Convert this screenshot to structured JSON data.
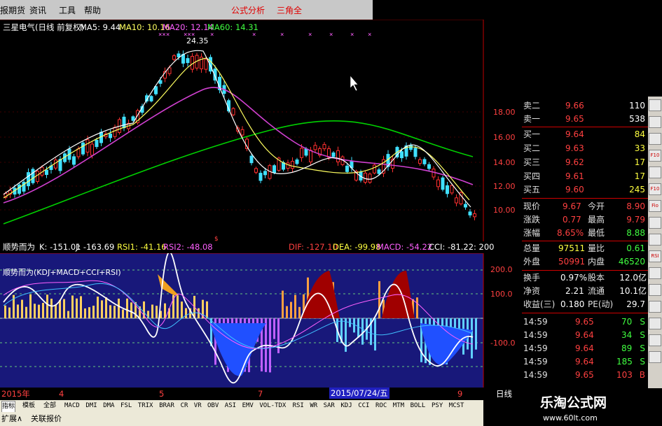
{
  "menu": {
    "items": [
      "报期货",
      "资讯",
      "工具",
      "帮助"
    ],
    "red_items": [
      "公式分析",
      "三角全"
    ]
  },
  "header": {
    "stock_name": "三星电气(日线 前复权)",
    "ma5": "MA5: 9.44",
    "ma10": "MA10: 10.16",
    "ma20": "MA20: 12.14",
    "ma60": "MA60: 14.31",
    "high_label": "24.35"
  },
  "price_axis": [
    "18.00",
    "16.00",
    "14.00",
    "12.00",
    "10.00"
  ],
  "indicator": {
    "name": "顺势而为",
    "k": "K: -151.01",
    "j": "J: -163.69",
    "rsi1": "RSI1: -41.16",
    "rsi2": "RSI2: -48.08",
    "dif": "DIF: -127.10",
    "dea": "DEA: -99.98",
    "macd": "MACD: -54.22",
    "cci": "CCI: -81.22",
    "extra": ": 200",
    "inner_title": "顺势而为(KDJ+MACD+CCI+RSI)"
  },
  "ind_axis": [
    "200.0",
    "100.0",
    "-100.0"
  ],
  "date_axis": {
    "year": "2015年",
    "m4": "4",
    "m5": "5",
    "m7": "7",
    "cursor_date": "2015/07/24/五",
    "m9": "9",
    "period": "日线"
  },
  "quote": {
    "sell2": {
      "label": "卖二",
      "price": "9.66",
      "vol": "110"
    },
    "sell1": {
      "label": "卖一",
      "price": "9.65",
      "vol": "538"
    },
    "buy1": {
      "label": "买一",
      "price": "9.64",
      "vol": "84"
    },
    "buy2": {
      "label": "买二",
      "price": "9.63",
      "vol": "33"
    },
    "buy3": {
      "label": "买三",
      "price": "9.62",
      "vol": "17"
    },
    "buy4": {
      "label": "买四",
      "price": "9.61",
      "vol": "17"
    },
    "buy5": {
      "label": "买五",
      "price": "9.60",
      "vol": "245"
    },
    "now": {
      "l1": "现价",
      "v1": "9.67",
      "l2": "今开",
      "v2": "8.90"
    },
    "chg": {
      "l1": "涨跌",
      "v1": "0.77",
      "l2": "最高",
      "v2": "9.79"
    },
    "pct": {
      "l1": "涨幅",
      "v1": "8.65%",
      "l2": "最低",
      "v2": "8.88"
    },
    "vol": {
      "l1": "总量",
      "v1": "97511",
      "l2": "量比",
      "v2": "0.61"
    },
    "outer": {
      "l1": "外盘",
      "v1": "50991",
      "l2": "内盘",
      "v2": "46520"
    },
    "turnover": {
      "l1": "换手",
      "v1": "0.97%",
      "l2": "股本",
      "v2": "12.0亿"
    },
    "nav": {
      "l1": "净资",
      "v1": "2.21",
      "l2": "流通",
      "v2": "10.1亿"
    },
    "eps": {
      "l1": "收益(三)",
      "v1": "0.180",
      "l2": "PE(动)",
      "v2": "29.7"
    }
  },
  "ticks": [
    {
      "time": "14:59",
      "price": "9.65",
      "vol": "70",
      "side": "S"
    },
    {
      "time": "14:59",
      "price": "9.64",
      "vol": "34",
      "side": "S"
    },
    {
      "time": "14:59",
      "price": "9.64",
      "vol": "89",
      "side": "S"
    },
    {
      "time": "14:59",
      "price": "9.64",
      "vol": "185",
      "side": "S"
    },
    {
      "time": "14:59",
      "price": "9.65",
      "vol": "103",
      "side": "B"
    }
  ],
  "tabs": [
    "指标",
    "模板",
    "全部",
    "MACD",
    "DMI",
    "DMA",
    "FSL",
    "TRIX",
    "BRAR",
    "CR",
    "VR",
    "OBV",
    "ASI",
    "EMV",
    "VOL-TDX",
    "RSI",
    "WR",
    "SAR",
    "KDJ",
    "CCI",
    "ROC",
    "MTM",
    "BOLL",
    "PSY",
    "MCST"
  ],
  "status": {
    "expand": "扩展∧",
    "related": "关联报价"
  },
  "side_tools": [
    "",
    "",
    "",
    "F10",
    "",
    "F10",
    "Fio",
    "",
    "",
    "RSI",
    "",
    "",
    "",
    "",
    "",
    ""
  ],
  "brand": {
    "name": "乐淘公式网",
    "url": "www.60lt.com"
  },
  "colors": {
    "up": "#ff3030",
    "down": "#40e0ff",
    "ma5": "#ffffff",
    "ma10": "#ffff00",
    "ma20": "#ff40ff",
    "ma60": "#00ff00",
    "panel": "#1a1a80"
  }
}
